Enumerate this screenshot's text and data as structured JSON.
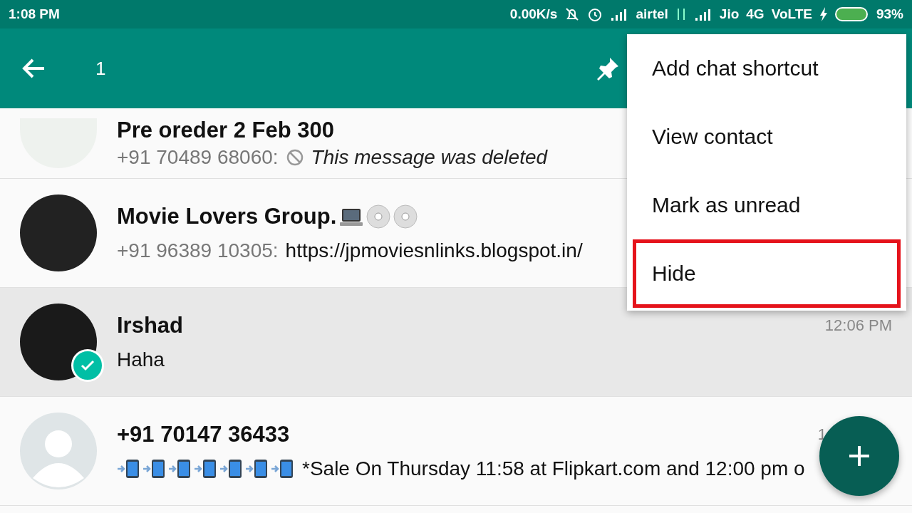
{
  "status_bar": {
    "time": "1:08 PM",
    "speed": "0.00K/s",
    "carrier_1": "airtel",
    "carrier_2": "Jio",
    "network": "4G",
    "volte": "VoLTE",
    "battery": "93%"
  },
  "app_bar": {
    "selected_count": "1"
  },
  "chats": [
    {
      "kind": "image",
      "name": "Pre oreder 2 Feb 300",
      "sender": "+91 70489 68060:",
      "message": "This message was deleted",
      "deleted": true,
      "selected": false
    },
    {
      "kind": "group",
      "name": "Movie Lovers Group.",
      "sender": "+91 96389 10305:",
      "message": "https://jpmoviesnlinks.blogspot.in/",
      "deleted": false,
      "selected": false,
      "name_emojis": true
    },
    {
      "kind": "person",
      "name": "Irshad",
      "message": "Haha",
      "deleted": false,
      "time": "12:06 PM",
      "selected": true
    },
    {
      "kind": "default",
      "name": "+91 70147 36433",
      "message": "*Sale On Thursday 11:58 at Flipkart.com and 12:00 pm o",
      "deleted": false,
      "time": "1",
      "selected": false,
      "message_emojis": true
    }
  ],
  "menu": [
    {
      "label": "Add chat shortcut",
      "highlighted": false
    },
    {
      "label": "View contact",
      "highlighted": false
    },
    {
      "label": "Mark as unread",
      "highlighted": false
    },
    {
      "label": "Hide",
      "highlighted": true
    }
  ]
}
